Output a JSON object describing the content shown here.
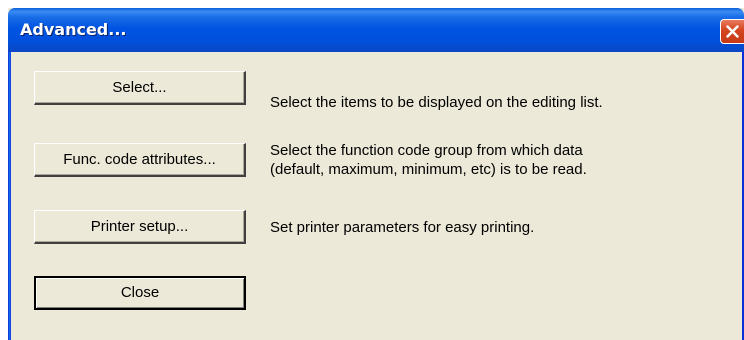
{
  "window": {
    "title": "Advanced..."
  },
  "rows": [
    {
      "button_label": "Select...",
      "description": [
        "Select the items to be displayed on the editing list."
      ]
    },
    {
      "button_label": "Func. code attributes...",
      "description": [
        "Select the function code group from which data",
        "(default, maximum, minimum, etc) is to be read."
      ]
    },
    {
      "button_label": "Printer setup...",
      "description": [
        "Set printer parameters for easy printing."
      ]
    }
  ],
  "close_button": {
    "label": "Close"
  },
  "colors": {
    "titlebar": "#0054e3",
    "dialog_background": "#ece9d8",
    "close_red": "#d4451f"
  },
  "icons": {
    "titlebar_close": "close-icon"
  }
}
